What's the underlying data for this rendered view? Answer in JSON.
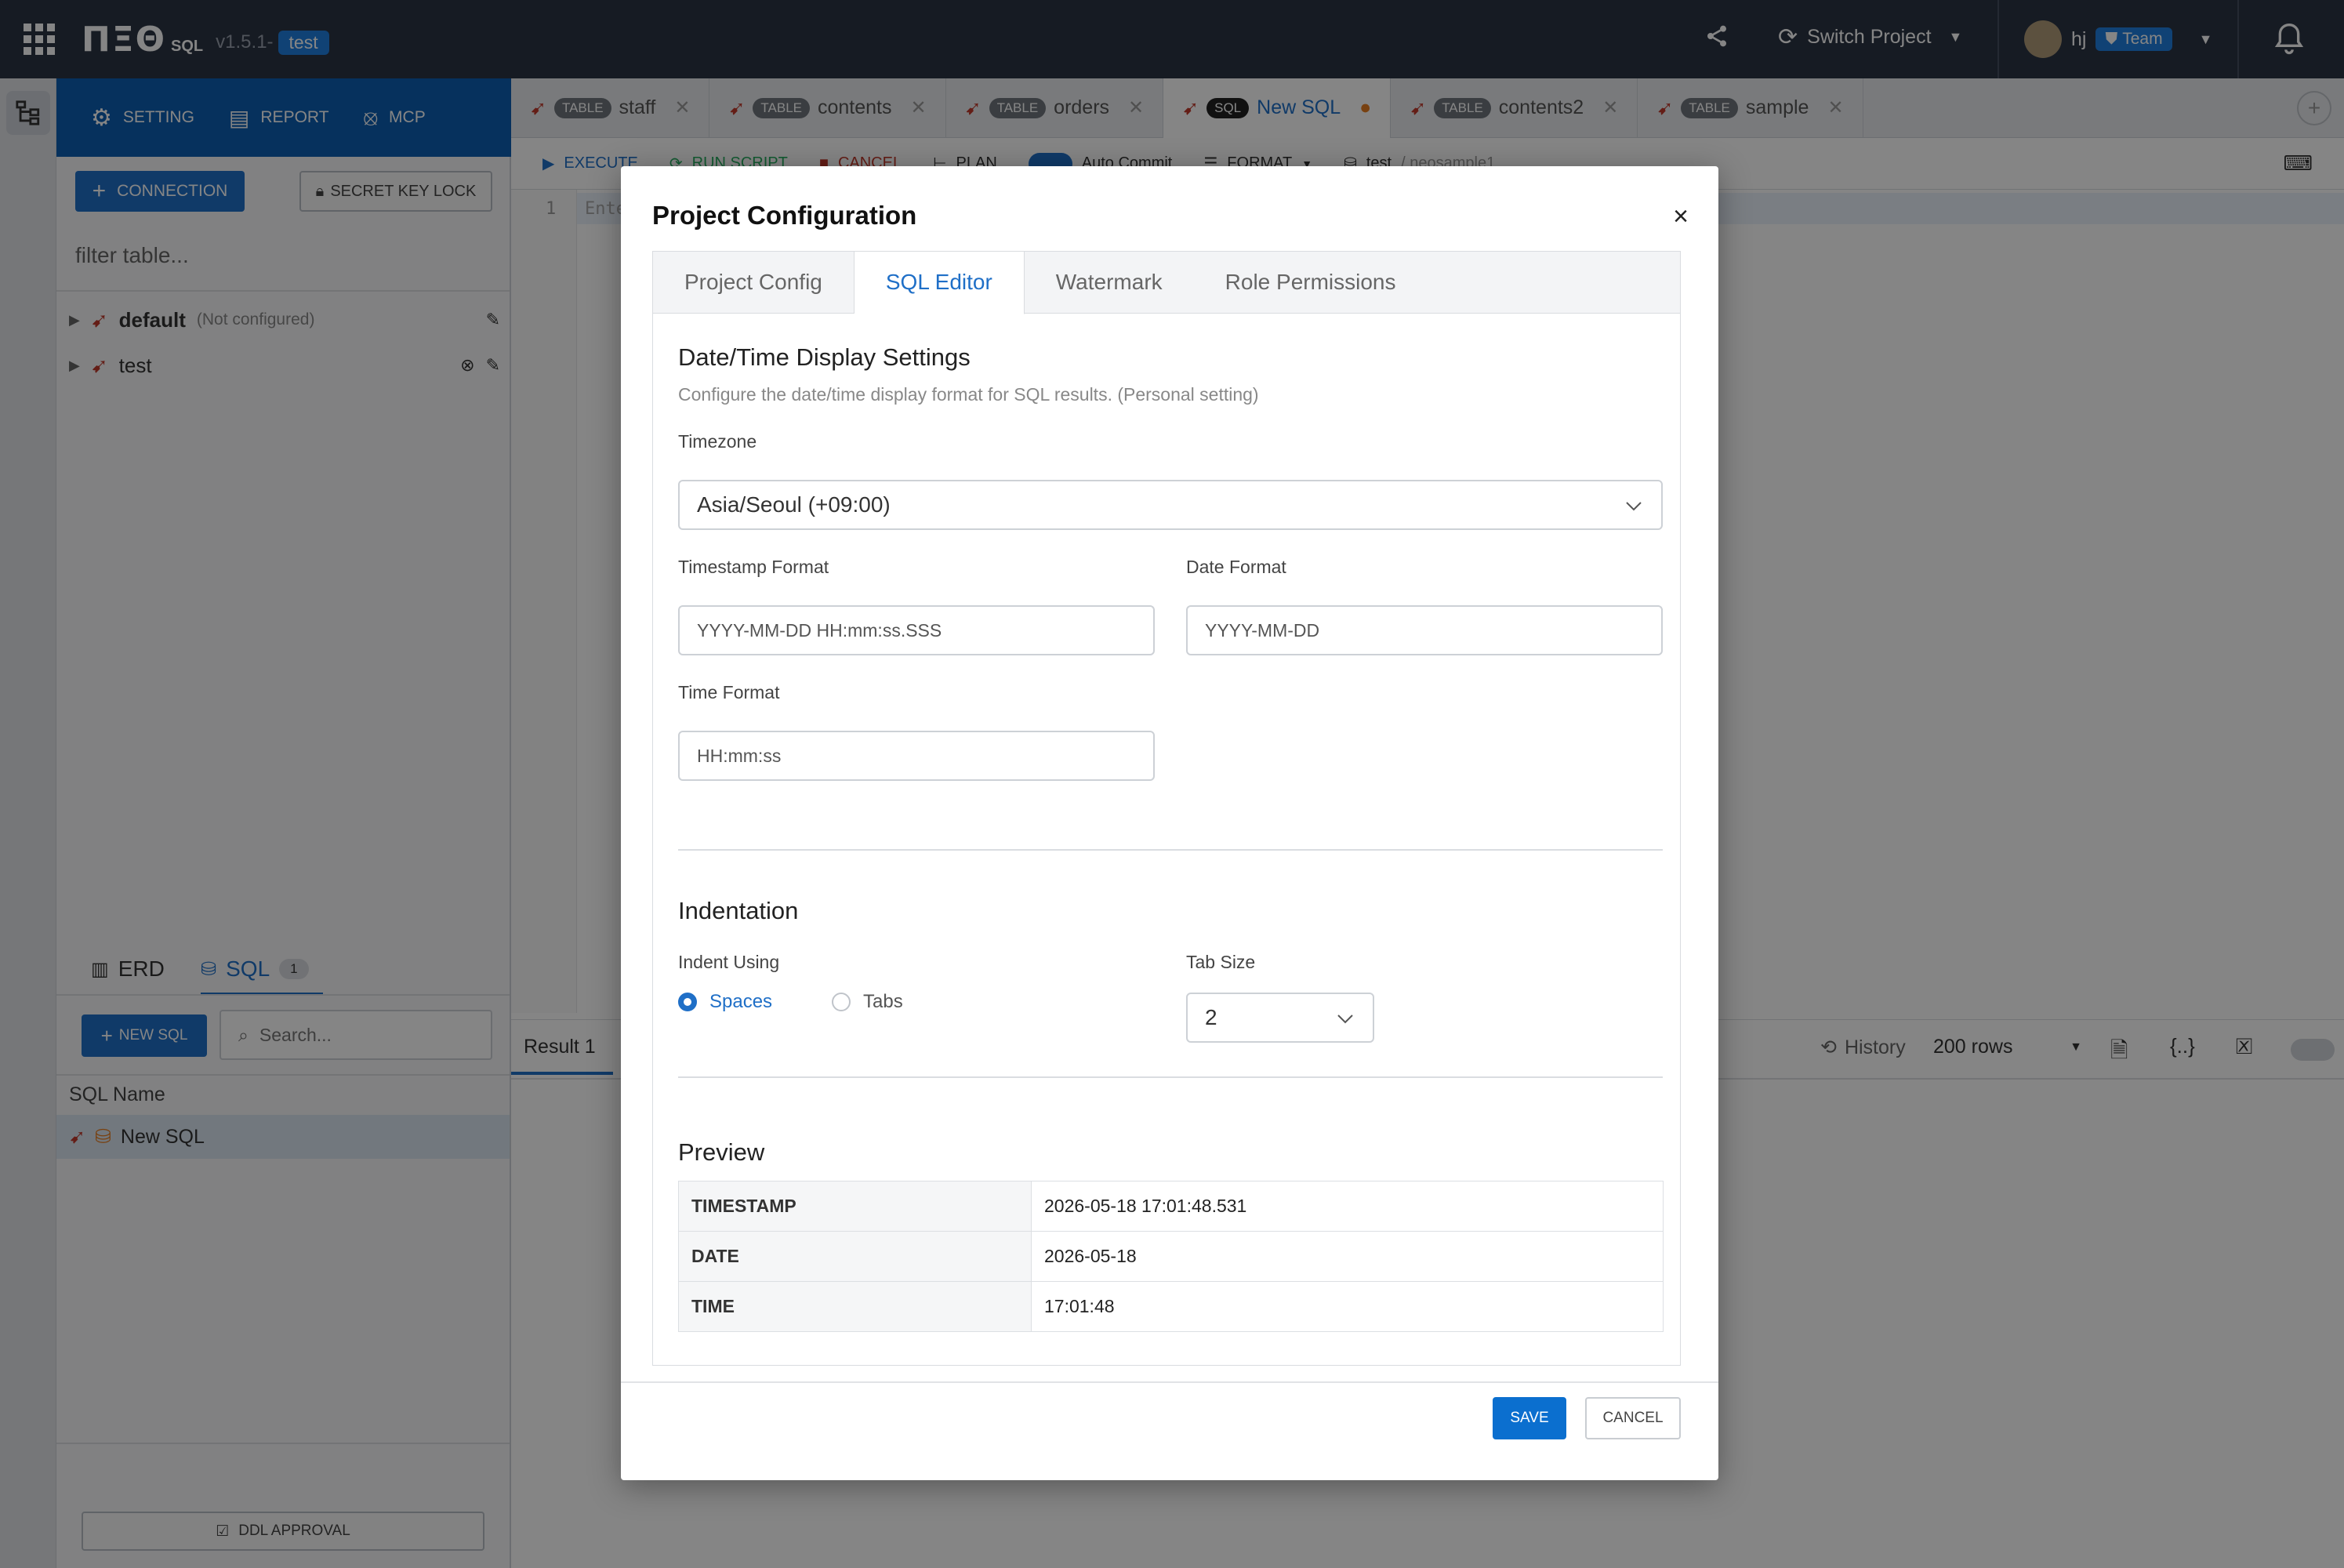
{
  "topbar": {
    "logo_mark": "ΠΞΘ",
    "logo_sql": "SQL",
    "version": "v1.5.1-",
    "env_badge": "test",
    "switch_project": "Switch Project",
    "user_name": "hj",
    "team_badge": "Team"
  },
  "sidebar_nav": {
    "setting": "SETTING",
    "report": "REPORT",
    "mcp": "MCP",
    "connection_button": "CONNECTION",
    "secret_key_lock": "SECRET KEY LOCK",
    "filter_placeholder": "filter table...",
    "connections": [
      {
        "name": "default",
        "note": "(Not configured)"
      },
      {
        "name": "test",
        "note": ""
      }
    ]
  },
  "editor_tabs": [
    {
      "tag": "TABLE",
      "name": "staff"
    },
    {
      "tag": "TABLE",
      "name": "contents"
    },
    {
      "tag": "TABLE",
      "name": "orders"
    },
    {
      "tag": "SQL",
      "name": "New SQL"
    },
    {
      "tag": "TABLE",
      "name": "contents2"
    },
    {
      "tag": "TABLE",
      "name": "sample"
    }
  ],
  "toolbar": {
    "execute": "EXECUTE",
    "run_script": "RUN SCRIPT",
    "cancel": "CANCEL",
    "plan": "PLAN",
    "auto_commit": "Auto Commit",
    "format": "FORMAT",
    "db": "test",
    "schema": "/ neosample1"
  },
  "editor": {
    "line_number": "1",
    "text": "Ente"
  },
  "bottom_left": {
    "erd_tab": "ERD",
    "sql_tab": "SQL",
    "sql_count": "1",
    "new_sql_button": "NEW SQL",
    "search_placeholder": "Search...",
    "list_header": "SQL Name",
    "list_items": [
      "New SQL"
    ],
    "ddl_approval": "DDL APPROVAL"
  },
  "results": {
    "tab": "Result 1",
    "history": "History",
    "rows": "200 rows"
  },
  "modal": {
    "title": "Project Configuration",
    "tabs": [
      "Project Config",
      "SQL Editor",
      "Watermark",
      "Role Permissions"
    ],
    "datetime": {
      "heading": "Date/Time Display Settings",
      "hint": "Configure the date/time display format for SQL results. (Personal setting)",
      "timezone_label": "Timezone",
      "timezone_value": "Asia/Seoul (+09:00)",
      "timestamp_label": "Timestamp Format",
      "timestamp_value": "YYYY-MM-DD HH:mm:ss.SSS",
      "date_label": "Date Format",
      "date_value": "YYYY-MM-DD",
      "time_label": "Time Format",
      "time_value": "HH:mm:ss"
    },
    "indentation": {
      "heading": "Indentation",
      "indent_label": "Indent Using",
      "spaces": "Spaces",
      "tabs": "Tabs",
      "tab_size_label": "Tab Size",
      "tab_size_value": "2"
    },
    "preview": {
      "heading": "Preview",
      "rows": [
        {
          "key": "TIMESTAMP",
          "value": "2026-05-18 17:01:48.531"
        },
        {
          "key": "DATE",
          "value": "2026-05-18"
        },
        {
          "key": "TIME",
          "value": "17:01:48"
        }
      ]
    },
    "save": "SAVE",
    "cancel": "CANCEL"
  },
  "colors": {
    "accent": "#1f6fc7",
    "topbar": "#2b3443",
    "nav": "#0d5fb3"
  }
}
